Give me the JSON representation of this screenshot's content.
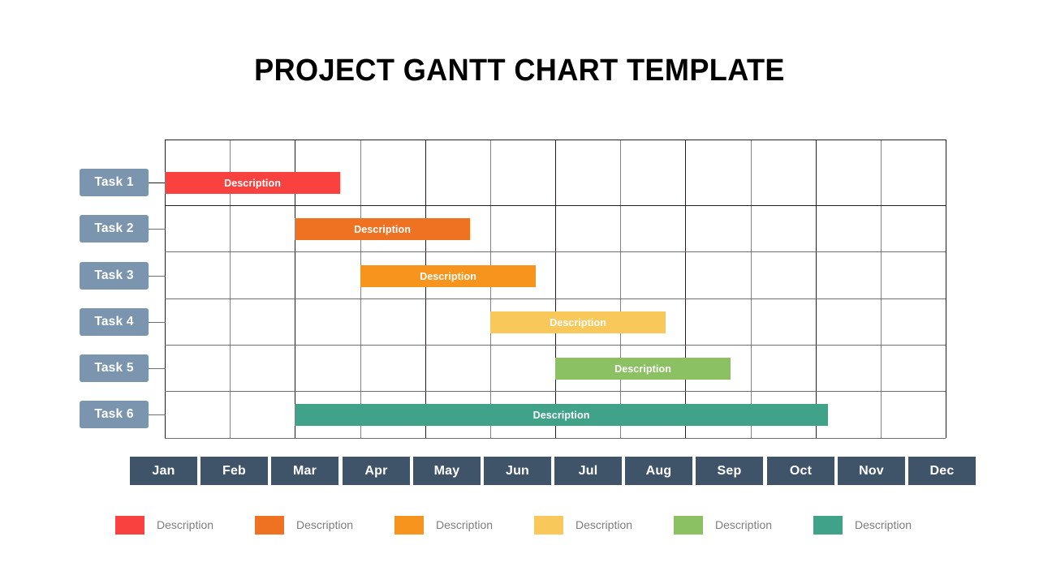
{
  "title": "PROJECT GANTT CHART TEMPLATE",
  "chart_data": {
    "type": "bar",
    "subtype": "gantt",
    "title": "PROJECT GANTT CHART TEMPLATE",
    "xlabel": "",
    "ylabel": "",
    "grid": true,
    "legend_position": "bottom",
    "categories": [
      "Jan",
      "Feb",
      "Mar",
      "Apr",
      "May",
      "Jun",
      "Jul",
      "Aug",
      "Sep",
      "Oct",
      "Nov",
      "Dec"
    ],
    "xlim": [
      0,
      12
    ],
    "tasks": [
      {
        "name": "Task 1",
        "label": "Description",
        "start_month": "Jan",
        "end_month": "Apr",
        "start": 0,
        "duration": 2.7,
        "color": "#F9423F"
      },
      {
        "name": "Task 2",
        "label": "Description",
        "start_month": "Mar",
        "end_month": "Jun",
        "start": 2,
        "duration": 2.7,
        "color": "#EF7122"
      },
      {
        "name": "Task 3",
        "label": "Description",
        "start_month": "Apr",
        "end_month": "Jul",
        "start": 3,
        "duration": 2.7,
        "color": "#F7941E"
      },
      {
        "name": "Task 4",
        "label": "Description",
        "start_month": "Jun",
        "end_month": "Sep",
        "start": 5,
        "duration": 2.7,
        "color": "#F9C85A"
      },
      {
        "name": "Task 5",
        "label": "Description",
        "start_month": "Jul",
        "end_month": "Oct",
        "start": 6,
        "duration": 2.7,
        "color": "#8CC163"
      },
      {
        "name": "Task 6",
        "label": "Description",
        "start_month": "Mar",
        "end_month": "Nov",
        "start": 2,
        "duration": 8.2,
        "color": "#3FA289"
      }
    ],
    "legend": [
      {
        "label": "Description",
        "color": "#F9423F"
      },
      {
        "label": "Description",
        "color": "#EF7122"
      },
      {
        "label": "Description",
        "color": "#F7941E"
      },
      {
        "label": "Description",
        "color": "#F9C85A"
      },
      {
        "label": "Description",
        "color": "#8CC163"
      },
      {
        "label": "Description",
        "color": "#3FA289"
      }
    ]
  },
  "tasks": [
    {
      "name": "Task 1",
      "bar_label": "Description"
    },
    {
      "name": "Task 2",
      "bar_label": "Description"
    },
    {
      "name": "Task 3",
      "bar_label": "Description"
    },
    {
      "name": "Task 4",
      "bar_label": "Description"
    },
    {
      "name": "Task 5",
      "bar_label": "Description"
    },
    {
      "name": "Task 6",
      "bar_label": "Description"
    }
  ],
  "months": [
    "Jan",
    "Feb",
    "Mar",
    "Apr",
    "May",
    "Jun",
    "Jul",
    "Aug",
    "Sep",
    "Oct",
    "Nov",
    "Dec"
  ],
  "legend": [
    {
      "label": "Description"
    },
    {
      "label": "Description"
    },
    {
      "label": "Description"
    },
    {
      "label": "Description"
    },
    {
      "label": "Description"
    },
    {
      "label": "Description"
    }
  ],
  "colors": {
    "task_label_bg": "#7a95ad",
    "month_bg": "#3f5468",
    "grid_dark": "#231f20",
    "grid_light": "#6d6e71",
    "legend_text": "#7d7d7d",
    "title": "#000000",
    "background": "#ffffff"
  }
}
